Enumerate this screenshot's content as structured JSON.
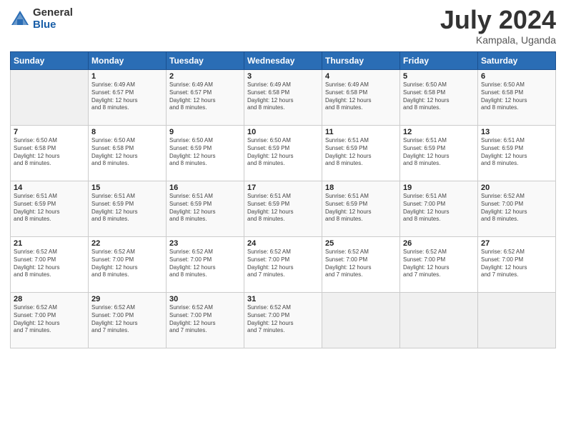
{
  "header": {
    "logo_general": "General",
    "logo_blue": "Blue",
    "month": "July 2024",
    "location": "Kampala, Uganda"
  },
  "weekdays": [
    "Sunday",
    "Monday",
    "Tuesday",
    "Wednesday",
    "Thursday",
    "Friday",
    "Saturday"
  ],
  "weeks": [
    [
      {
        "day": "",
        "info": ""
      },
      {
        "day": "1",
        "info": "Sunrise: 6:49 AM\nSunset: 6:57 PM\nDaylight: 12 hours\nand 8 minutes."
      },
      {
        "day": "2",
        "info": "Sunrise: 6:49 AM\nSunset: 6:57 PM\nDaylight: 12 hours\nand 8 minutes."
      },
      {
        "day": "3",
        "info": "Sunrise: 6:49 AM\nSunset: 6:58 PM\nDaylight: 12 hours\nand 8 minutes."
      },
      {
        "day": "4",
        "info": "Sunrise: 6:49 AM\nSunset: 6:58 PM\nDaylight: 12 hours\nand 8 minutes."
      },
      {
        "day": "5",
        "info": "Sunrise: 6:50 AM\nSunset: 6:58 PM\nDaylight: 12 hours\nand 8 minutes."
      },
      {
        "day": "6",
        "info": "Sunrise: 6:50 AM\nSunset: 6:58 PM\nDaylight: 12 hours\nand 8 minutes."
      }
    ],
    [
      {
        "day": "7",
        "info": "Sunrise: 6:50 AM\nSunset: 6:58 PM\nDaylight: 12 hours\nand 8 minutes."
      },
      {
        "day": "8",
        "info": "Sunrise: 6:50 AM\nSunset: 6:58 PM\nDaylight: 12 hours\nand 8 minutes."
      },
      {
        "day": "9",
        "info": "Sunrise: 6:50 AM\nSunset: 6:59 PM\nDaylight: 12 hours\nand 8 minutes."
      },
      {
        "day": "10",
        "info": "Sunrise: 6:50 AM\nSunset: 6:59 PM\nDaylight: 12 hours\nand 8 minutes."
      },
      {
        "day": "11",
        "info": "Sunrise: 6:51 AM\nSunset: 6:59 PM\nDaylight: 12 hours\nand 8 minutes."
      },
      {
        "day": "12",
        "info": "Sunrise: 6:51 AM\nSunset: 6:59 PM\nDaylight: 12 hours\nand 8 minutes."
      },
      {
        "day": "13",
        "info": "Sunrise: 6:51 AM\nSunset: 6:59 PM\nDaylight: 12 hours\nand 8 minutes."
      }
    ],
    [
      {
        "day": "14",
        "info": "Sunrise: 6:51 AM\nSunset: 6:59 PM\nDaylight: 12 hours\nand 8 minutes."
      },
      {
        "day": "15",
        "info": "Sunrise: 6:51 AM\nSunset: 6:59 PM\nDaylight: 12 hours\nand 8 minutes."
      },
      {
        "day": "16",
        "info": "Sunrise: 6:51 AM\nSunset: 6:59 PM\nDaylight: 12 hours\nand 8 minutes."
      },
      {
        "day": "17",
        "info": "Sunrise: 6:51 AM\nSunset: 6:59 PM\nDaylight: 12 hours\nand 8 minutes."
      },
      {
        "day": "18",
        "info": "Sunrise: 6:51 AM\nSunset: 6:59 PM\nDaylight: 12 hours\nand 8 minutes."
      },
      {
        "day": "19",
        "info": "Sunrise: 6:51 AM\nSunset: 7:00 PM\nDaylight: 12 hours\nand 8 minutes."
      },
      {
        "day": "20",
        "info": "Sunrise: 6:52 AM\nSunset: 7:00 PM\nDaylight: 12 hours\nand 8 minutes."
      }
    ],
    [
      {
        "day": "21",
        "info": "Sunrise: 6:52 AM\nSunset: 7:00 PM\nDaylight: 12 hours\nand 8 minutes."
      },
      {
        "day": "22",
        "info": "Sunrise: 6:52 AM\nSunset: 7:00 PM\nDaylight: 12 hours\nand 8 minutes."
      },
      {
        "day": "23",
        "info": "Sunrise: 6:52 AM\nSunset: 7:00 PM\nDaylight: 12 hours\nand 8 minutes."
      },
      {
        "day": "24",
        "info": "Sunrise: 6:52 AM\nSunset: 7:00 PM\nDaylight: 12 hours\nand 7 minutes."
      },
      {
        "day": "25",
        "info": "Sunrise: 6:52 AM\nSunset: 7:00 PM\nDaylight: 12 hours\nand 7 minutes."
      },
      {
        "day": "26",
        "info": "Sunrise: 6:52 AM\nSunset: 7:00 PM\nDaylight: 12 hours\nand 7 minutes."
      },
      {
        "day": "27",
        "info": "Sunrise: 6:52 AM\nSunset: 7:00 PM\nDaylight: 12 hours\nand 7 minutes."
      }
    ],
    [
      {
        "day": "28",
        "info": "Sunrise: 6:52 AM\nSunset: 7:00 PM\nDaylight: 12 hours\nand 7 minutes."
      },
      {
        "day": "29",
        "info": "Sunrise: 6:52 AM\nSunset: 7:00 PM\nDaylight: 12 hours\nand 7 minutes."
      },
      {
        "day": "30",
        "info": "Sunrise: 6:52 AM\nSunset: 7:00 PM\nDaylight: 12 hours\nand 7 minutes."
      },
      {
        "day": "31",
        "info": "Sunrise: 6:52 AM\nSunset: 7:00 PM\nDaylight: 12 hours\nand 7 minutes."
      },
      {
        "day": "",
        "info": ""
      },
      {
        "day": "",
        "info": ""
      },
      {
        "day": "",
        "info": ""
      }
    ]
  ]
}
